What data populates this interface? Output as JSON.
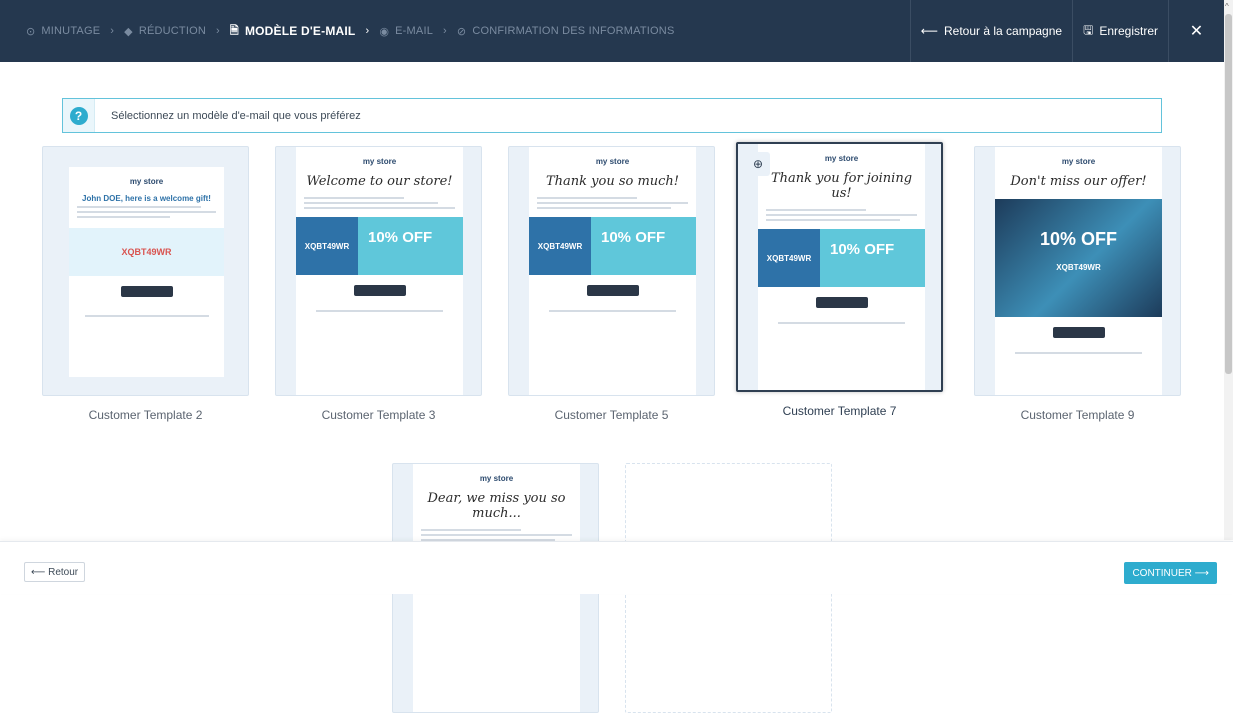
{
  "steps": [
    {
      "icon": "⊙",
      "label": "MINUTAGE",
      "active": false
    },
    {
      "icon": "◆",
      "label": "RÉDUCTION",
      "active": false
    },
    {
      "icon": "🗎",
      "label": "MODÈLE D'E-MAIL",
      "active": true
    },
    {
      "icon": "◉",
      "label": "E-MAIL",
      "active": false
    },
    {
      "icon": "⊘",
      "label": "CONFIRMATION DES INFORMATIONS",
      "active": false
    }
  ],
  "step_separator": "›",
  "header": {
    "back_campaign_label": "Retour à la campagne",
    "save_label": "Enregistrer",
    "close_glyph": "✕"
  },
  "notice": {
    "icon": "?",
    "text": "Sélectionnez un modèle d'e-mail que vous préférez"
  },
  "templates": [
    {
      "name": "Customer Template 2",
      "logo": "my store",
      "heading": "John DOE, here is a welcome gift!",
      "code": "XQBT49WR",
      "button": "SHOP NOW"
    },
    {
      "name": "Customer Template 3",
      "logo": "my store",
      "heading": "Welcome to our store!",
      "code": "XQBT49WR",
      "offer": "10% OFF",
      "button": "SHOP NOW"
    },
    {
      "name": "Customer Template 5",
      "logo": "my store",
      "heading": "Thank you so much!",
      "code": "XQBT49WR",
      "offer": "10% OFF",
      "button": "GO TO SHOP"
    },
    {
      "name": "Customer Template 7",
      "logo": "my store",
      "heading": "Thank you for joining us!",
      "code": "XQBT49WR",
      "offer": "10% OFF",
      "button": "SHOP NOW",
      "selected": true
    },
    {
      "name": "Customer Template 9",
      "logo": "my store",
      "heading": "Don't miss our offer!",
      "code": "XQBT49WR",
      "offer": "10% OFF",
      "button": "SHOP NOW"
    },
    {
      "name": "",
      "logo": "my store",
      "heading": "Dear, we miss you so much..."
    }
  ],
  "footer": {
    "back_label": "⟵ Retour",
    "continue_label": "CONTINUER ⟶"
  },
  "colors": {
    "topbar": "#25384f",
    "accent": "#2eacce",
    "selected_border": "#2f3f52"
  }
}
